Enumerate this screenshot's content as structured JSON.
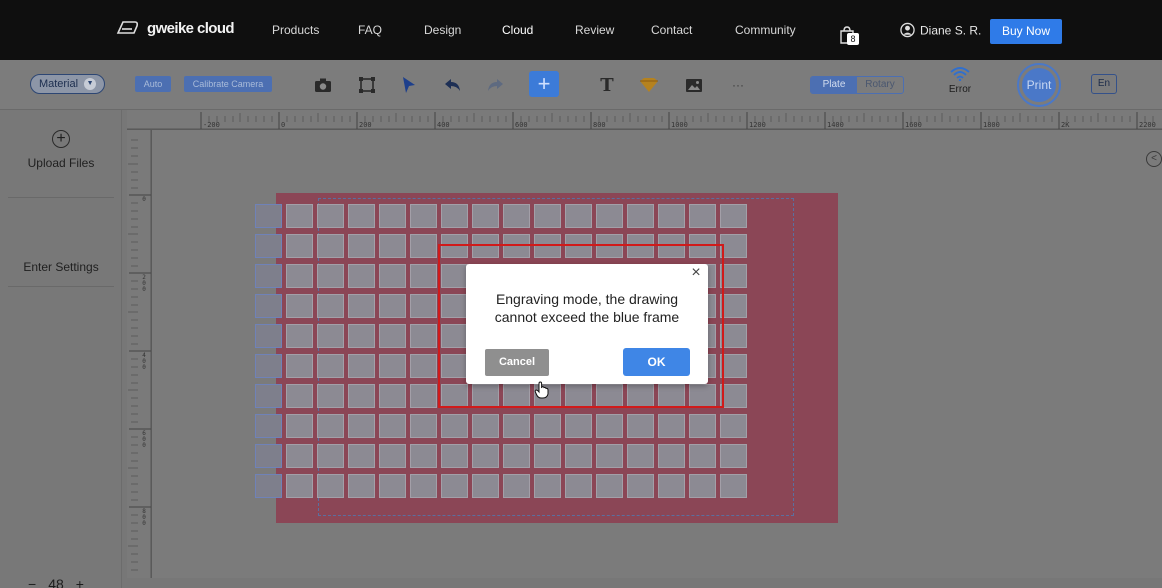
{
  "nav": {
    "brand": "gweike cloud",
    "items": [
      {
        "label": "Products",
        "active": false
      },
      {
        "label": "FAQ",
        "active": false
      },
      {
        "label": "Design",
        "active": false
      },
      {
        "label": "Cloud",
        "active": true
      },
      {
        "label": "Review",
        "active": false
      },
      {
        "label": "Contact",
        "active": false
      },
      {
        "label": "Community",
        "active": false
      }
    ],
    "cart_count": "8",
    "user": "Diane S. R.",
    "buy_label": "Buy Now"
  },
  "toolbar": {
    "material_label": "Material",
    "auto_label": "Auto",
    "calibrate_label": "Calibrate Camera",
    "tools": [
      "camera-icon",
      "crop-icon",
      "select-arrow-icon",
      "undo-icon",
      "redo-icon",
      "add-icon",
      "text-icon",
      "shape-icon",
      "image-icon",
      "more-icon"
    ],
    "more_label": "···",
    "plate_label": "Plate",
    "rotary_label": "Rotary",
    "status_label": "Error",
    "print_label": "Print",
    "lang_label": "En"
  },
  "sidebar": {
    "upload_label": "Upload Files",
    "settings_label": "Enter Settings"
  },
  "ruler": {
    "h_labels": [
      "-200",
      "0",
      "200",
      "400",
      "600",
      "800",
      "1000",
      "1200",
      "1400",
      "1600",
      "1800",
      "2K",
      "2200"
    ],
    "v_labels": [
      "0",
      "200",
      "400",
      "600",
      "800"
    ]
  },
  "dialog": {
    "message": "Engraving mode, the drawing cannot exceed the blue frame",
    "cancel_label": "Cancel",
    "ok_label": "OK"
  },
  "zoom": {
    "minus": "−",
    "value": "48",
    "plus": "+"
  },
  "colors": {
    "nav_bg": "#0f0f0f",
    "accent": "#2f7be8",
    "panel": "#8b4656",
    "alert_outline": "#d11a1a"
  }
}
